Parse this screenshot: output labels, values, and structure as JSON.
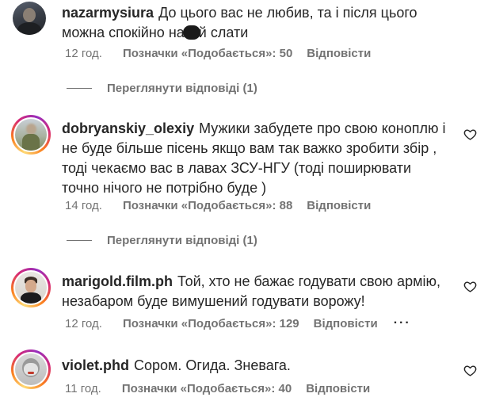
{
  "comments": [
    {
      "username": "nazarmysiura",
      "text_before": "До цього вас не любив, та і після цього можна спокійно на",
      "text_after": "й слати",
      "time": "12 год.",
      "likes": "Позначки «Подобається»: 50",
      "reply": "Відповісти",
      "view_replies": "Переглянути відповіді (1)"
    },
    {
      "username": "dobryanskiy_olexiy",
      "text": "Мужики забудете про свою коноплю і не буде більше пісень якщо вам так важко зробити збір , тоді чекаємо вас в лавах ЗСУ-НГУ (тоді поширювати точно нічого не потрібно буде )",
      "time": "14 год.",
      "likes": "Позначки «Подобається»: 88",
      "reply": "Відповісти",
      "view_replies": "Переглянути відповіді (1)"
    },
    {
      "username": "marigold.film.ph",
      "text": "Той, хто не бажає годувати свою армію, незабаром буде вимушений годувати ворожу!",
      "time": "12 год.",
      "likes": "Позначки «Подобається»: 129",
      "reply": "Відповісти",
      "more": "···"
    },
    {
      "username": "violet.phd",
      "text": "Сором. Огида. Зневага.",
      "time": "11 год.",
      "likes": "Позначки «Подобається»: 40",
      "reply": "Відповісти"
    }
  ],
  "icons": {
    "like": "heart-outline-icon",
    "avatar": "avatar-image"
  }
}
